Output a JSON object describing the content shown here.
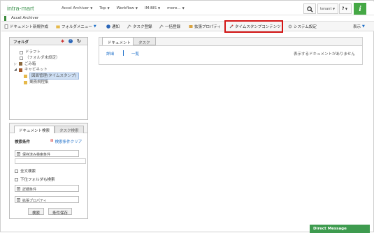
{
  "brand": "intra-mart",
  "topnav": [
    {
      "label": "Accel Archiver"
    },
    {
      "label": "Top"
    },
    {
      "label": "Workflow"
    },
    {
      "label": "IM-BIS"
    },
    {
      "label": "more..."
    }
  ],
  "tenant": "tenant",
  "help": "?",
  "app_title": "Accel Archiver",
  "toolbar": {
    "new_doc": "ドキュメント新規作成",
    "folder_menu": "フォルダメニュー",
    "notify": "通知",
    "task_reg": "タスク登録",
    "bulk_reg": "一括登録",
    "ext_prop": "拡張プロパティ",
    "timestamp": "タイムスタンプコンテンツ",
    "sys_settings": "システム設定",
    "display": "表示"
  },
  "folder_panel": {
    "title": "フォルダ",
    "tree": [
      {
        "label": "ドラフト"
      },
      {
        "label": "（フォルダ未設定）"
      },
      {
        "label": "ごみ箱"
      },
      {
        "label": "キャビネット"
      },
      {
        "label": "図面管理(タイムスタンプ)"
      },
      {
        "label": "業務規程集"
      }
    ]
  },
  "search_panel": {
    "tab_doc": "ドキュメント検索",
    "tab_task": "タスク検索",
    "conditions": "検索条件",
    "clear": "検索条件クリア",
    "saved": "保存済み検索条件",
    "fulltext": "全文検索",
    "subfolder": "下位フォルダも検索",
    "detail": "詳細条件",
    "ext": "拡張プロパティ",
    "search_btn": "検索",
    "save_btn": "条件保存"
  },
  "main": {
    "tab_doc": "ドキュメント",
    "tab_task": "タスク",
    "detail": "詳細",
    "list": "一覧",
    "empty": "表示するドキュメントがありません"
  },
  "direct_message": "Direct Message"
}
